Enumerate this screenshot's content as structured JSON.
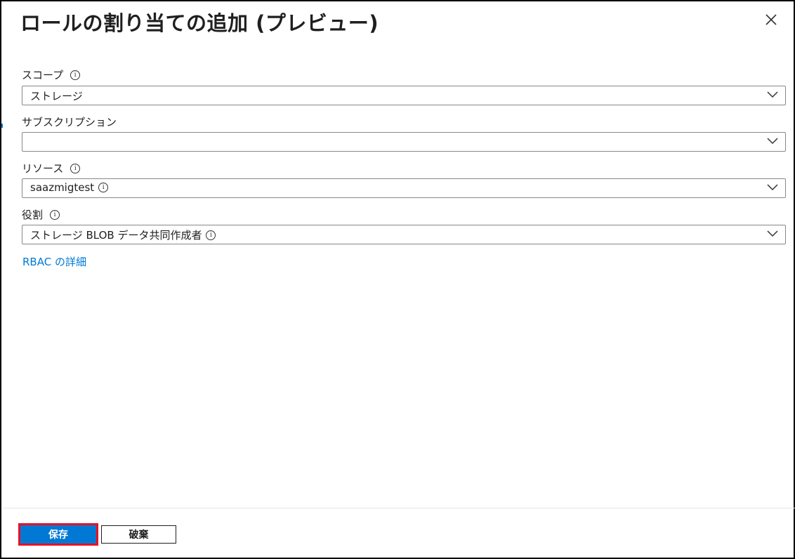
{
  "panel": {
    "title": "ロールの割り当ての追加 (プレビュー)"
  },
  "fields": {
    "scope": {
      "label": "スコープ",
      "value": "ストレージ"
    },
    "subscription": {
      "label": "サブスクリプション",
      "value": ""
    },
    "resource": {
      "label": "リソース",
      "value": "saazmigtest"
    },
    "role": {
      "label": "役割",
      "value": "ストレージ BLOB データ共同作成者"
    }
  },
  "info_glyph": "i",
  "links": {
    "rbac_details": "RBAC の詳細"
  },
  "footer": {
    "save_label": "保存",
    "discard_label": "破棄"
  },
  "colors": {
    "accent": "#0078d4",
    "highlight": "#e81123",
    "border": "#8a8886"
  }
}
